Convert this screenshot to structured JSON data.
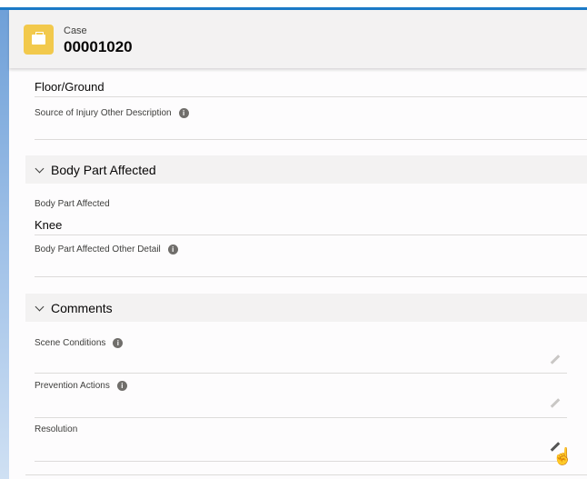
{
  "header": {
    "object_label": "Case",
    "record_number": "00001020"
  },
  "fields_top": {
    "source_value": "Floor/Ground",
    "source_other_label": "Source of Injury Other Description"
  },
  "sections": [
    {
      "title": "Body Part Affected",
      "fields": [
        {
          "label": "Body Part Affected",
          "value": "Knee"
        },
        {
          "label": "Body Part Affected Other Detail",
          "value": ""
        }
      ]
    },
    {
      "title": "Comments",
      "fields": [
        {
          "label": "Scene Conditions"
        },
        {
          "label": "Prevention Actions"
        },
        {
          "label": "Resolution"
        }
      ]
    }
  ],
  "icons": {
    "info": "i",
    "cursor": "☝"
  },
  "colors": {
    "accent": "#1b7ac7",
    "case_icon": "#f2c94c"
  }
}
